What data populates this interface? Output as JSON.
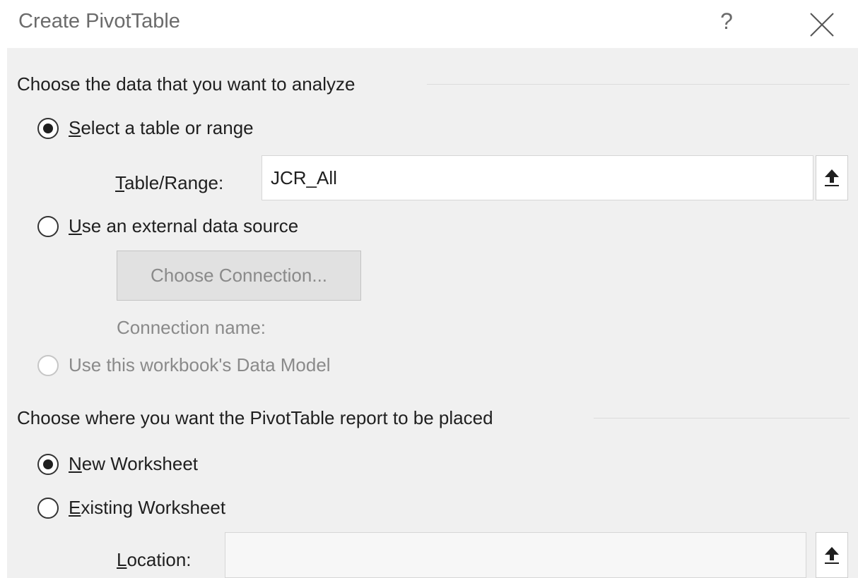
{
  "window": {
    "title": "Create PivotTable",
    "help_label": "?"
  },
  "source_section": {
    "header": "Choose the data that you want to analyze",
    "options": [
      {
        "label": "Select a table or range",
        "checked": true,
        "disabled": false
      },
      {
        "label": "Use an external data source",
        "checked": false,
        "disabled": false
      },
      {
        "label": "Use this workbook's Data Model",
        "checked": false,
        "disabled": true
      }
    ],
    "table_range": {
      "label": "Table/Range:",
      "value": "JCR_All"
    },
    "choose_connection_label": "Choose Connection...",
    "connection_name_label": "Connection name:"
  },
  "placement_section": {
    "header": "Choose where you want the PivotTable report to be placed",
    "options": [
      {
        "label": "New Worksheet",
        "checked": true
      },
      {
        "label": "Existing Worksheet",
        "checked": false
      }
    ],
    "location": {
      "label": "Location:",
      "value": ""
    }
  },
  "icons": {
    "collapse_dialog": "collapse-dialog-icon",
    "close": "close-icon"
  },
  "colors": {
    "dialog_background": "#f0f0f0",
    "title_text": "#6b6b6b",
    "disabled_text": "#8a8a8a"
  }
}
